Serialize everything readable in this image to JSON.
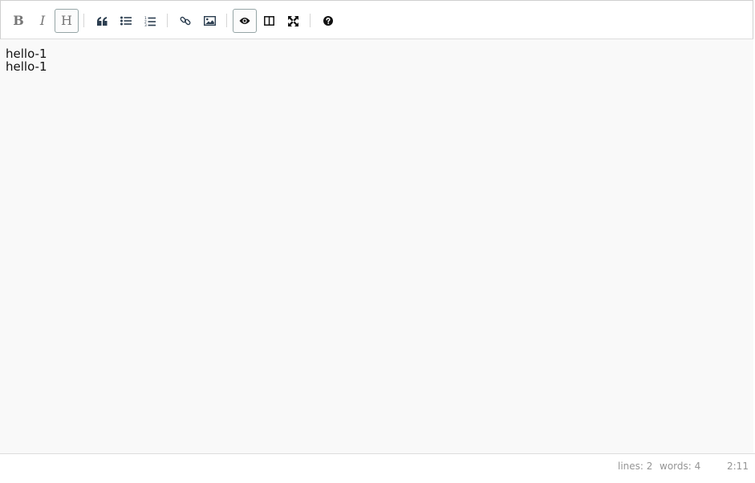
{
  "toolbar": {
    "bold_label": "B",
    "italic_label": "I",
    "heading_label": "H",
    "buttons": [
      {
        "name": "bold"
      },
      {
        "name": "italic"
      },
      {
        "name": "heading",
        "active": true
      },
      {
        "name": "quote"
      },
      {
        "name": "unordered-list"
      },
      {
        "name": "ordered-list"
      },
      {
        "name": "link"
      },
      {
        "name": "image"
      },
      {
        "name": "preview",
        "active": true
      },
      {
        "name": "side-by-side"
      },
      {
        "name": "fullscreen"
      },
      {
        "name": "guide"
      }
    ]
  },
  "editor": {
    "lines": [
      "hello-1",
      "hello-1"
    ]
  },
  "status": {
    "lines_label": "lines: 2",
    "words_label": "words: 4",
    "cursor": "2:11"
  },
  "colors": {
    "content_bg": "#f9f9f9",
    "toolbar_icon": "#2c3e50",
    "status_text": "#959595"
  }
}
